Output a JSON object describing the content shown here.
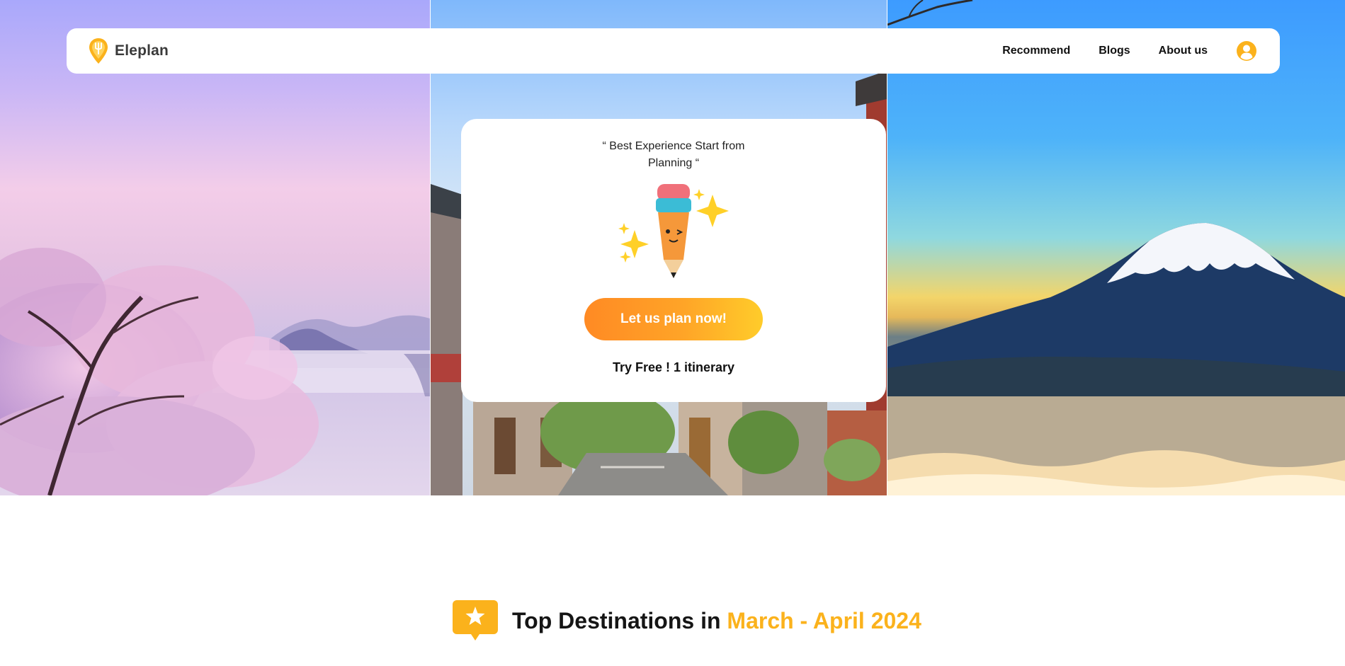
{
  "brand": {
    "name": "Eleplan",
    "accent_color": "#fbb21c"
  },
  "nav": {
    "links": [
      {
        "label": "Recommend"
      },
      {
        "label": "Blogs"
      },
      {
        "label": "About us"
      }
    ],
    "account_icon": "user-circle-icon"
  },
  "hero": {
    "images": [
      "cherry-blossom-mountains",
      "traditional-village-street",
      "snow-capped-volcano"
    ],
    "card": {
      "tagline": "“ Best Experience Start from Planning “",
      "illustration": "pencil-sparkles-icon",
      "cta_label": "Let us plan now!",
      "trial_text": "Try Free ! 1 itinerary"
    }
  },
  "section": {
    "icon": "star-badge-icon",
    "title_prefix": "Top Destinations in",
    "title_highlight": "March - April 2024"
  },
  "colors": {
    "cta_gradient_start": "#ff8a24",
    "cta_gradient_end": "#ffcc2a",
    "highlight": "#fbb21c"
  }
}
